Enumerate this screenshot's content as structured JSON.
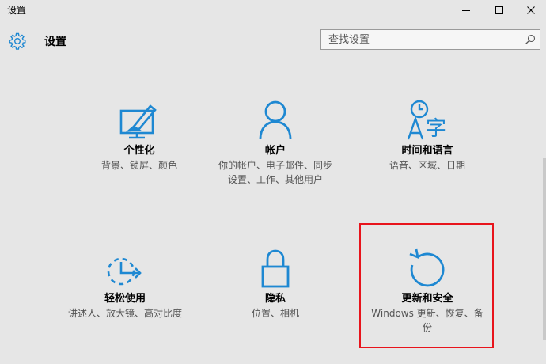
{
  "window": {
    "title": "设置",
    "minimize_glyph": "—",
    "maximize_glyph": "☐",
    "close_glyph": "✕"
  },
  "header": {
    "title": "设置",
    "icon": "gear-icon"
  },
  "search": {
    "placeholder": "查找设置",
    "icon": "search-icon"
  },
  "tiles": [
    {
      "icon": "personalization-icon",
      "title": "个性化",
      "desc": "背景、锁屏、颜色"
    },
    {
      "icon": "accounts-icon",
      "title": "帐户",
      "desc": "你的帐户、电子邮件、同步设置、工作、其他用户"
    },
    {
      "icon": "time-language-icon",
      "title": "时间和语言",
      "desc": "语音、区域、日期"
    },
    {
      "icon": "ease-of-access-icon",
      "title": "轻松使用",
      "desc": "讲述人、放大镜、高对比度"
    },
    {
      "icon": "privacy-icon",
      "title": "隐私",
      "desc": "位置、相机"
    },
    {
      "icon": "update-security-icon",
      "title": "更新和安全",
      "desc": "Windows 更新、恢复、备份"
    }
  ],
  "colors": {
    "accent": "#1e88d2",
    "highlight": "#e8141c",
    "background": "#e6e6e6"
  }
}
